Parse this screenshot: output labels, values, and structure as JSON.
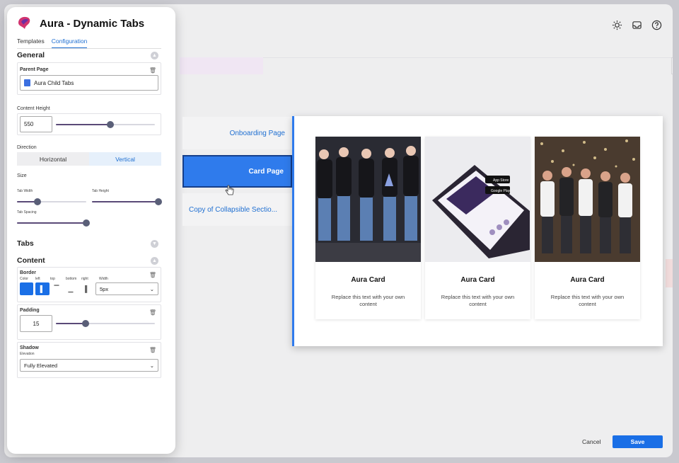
{
  "app": {
    "title": "Aura - Dynamic Tabs",
    "tabs": [
      {
        "label": "Templates"
      },
      {
        "label": "Configuration"
      }
    ]
  },
  "general": {
    "title": "General",
    "parent_page": {
      "label": "Parent Page",
      "value": "Aura Child Tabs"
    },
    "content_height": {
      "label": "Content Height",
      "value": "550",
      "level": 0.55
    },
    "direction": {
      "label": "Direction",
      "options": [
        "Horizontal",
        "Vertical"
      ],
      "selected": "Vertical"
    },
    "size": {
      "label": "Size",
      "tab_width": {
        "label": "Tab Width",
        "level": 0.3
      },
      "tab_height": {
        "label": "Tab Height",
        "level": 1.0
      },
      "tab_spacing": {
        "label": "Tab Spacing",
        "level": 1.0
      }
    }
  },
  "tabs_section": {
    "title": "Tabs"
  },
  "content_section": {
    "title": "Content",
    "border": {
      "label": "Border",
      "labels": {
        "color": "Color",
        "left": "left",
        "top": "top",
        "bottom": "bottom",
        "right": "right",
        "width": "Width"
      },
      "color": "#1a6fe6",
      "width_value": "5px"
    },
    "padding": {
      "label": "Padding",
      "value": "15",
      "level": 0.3
    },
    "shadow": {
      "label": "Shadow",
      "elevation_label": "Elevation",
      "value": "Fully Elevated"
    }
  },
  "preview": {
    "tabs": [
      {
        "label": "Onboarding Page"
      },
      {
        "label": "Card Page"
      },
      {
        "label": "Copy of Collapsible Sectio..."
      }
    ],
    "active_tab": "Card Page",
    "cards": [
      {
        "title": "Aura Card",
        "text": "Replace this text with your own content",
        "image": "team-photo"
      },
      {
        "title": "Aura Card",
        "text": "Replace this text with your own content",
        "image": "phone-app-mockup"
      },
      {
        "title": "Aura Card",
        "text": "Replace this text with your own content",
        "image": "event-crowd-photo"
      }
    ],
    "background_tab_text": "Co"
  },
  "footer": {
    "cancel": "Cancel",
    "save": "Save"
  },
  "icons": [
    "sun-icon",
    "inbox-icon",
    "help-icon",
    "trash-icon",
    "chevron-up-icon",
    "chevron-down-icon",
    "document-icon",
    "cursor-icon"
  ],
  "colors": {
    "accent": "#1a6fe6",
    "active_tab": "#2f7bec",
    "slider": "#5a4a78"
  }
}
